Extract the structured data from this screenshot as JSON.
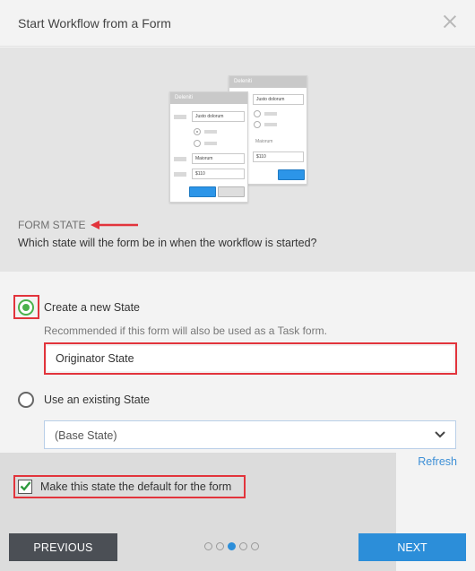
{
  "dialog": {
    "title": "Start Workflow from a Form"
  },
  "illustration": {
    "back_card": {
      "header": "Deleniti",
      "input1": "Justo dolorum",
      "caption": "Maiorum",
      "input2": "$110"
    },
    "front_card": {
      "header": "Deleniti",
      "input1": "Justo dolorum",
      "input2": "Maiorum",
      "input3": "$110"
    }
  },
  "section": {
    "label": "FORM STATE",
    "question": "Which state will the form be in when the workflow is started?"
  },
  "options": {
    "new_state": {
      "label": "Create a new State",
      "checked": true,
      "hint": "Recommended if this form will also be used as a Task form.",
      "input_value": "Originator State"
    },
    "existing_state": {
      "label": "Use an existing State",
      "checked": false,
      "select_value": "(Base State)",
      "refresh_label": "Refresh"
    }
  },
  "default_checkbox": {
    "label": "Make this state the default for the form",
    "checked": true
  },
  "footer": {
    "previous_label": "PREVIOUS",
    "next_label": "NEXT",
    "steps_total": 5,
    "current_step": 3
  },
  "colors": {
    "accent": "#2c8ed9",
    "radio_checked": "#4bb14c",
    "annotation": "#e2343c",
    "previous_button": "#4b4f55"
  }
}
